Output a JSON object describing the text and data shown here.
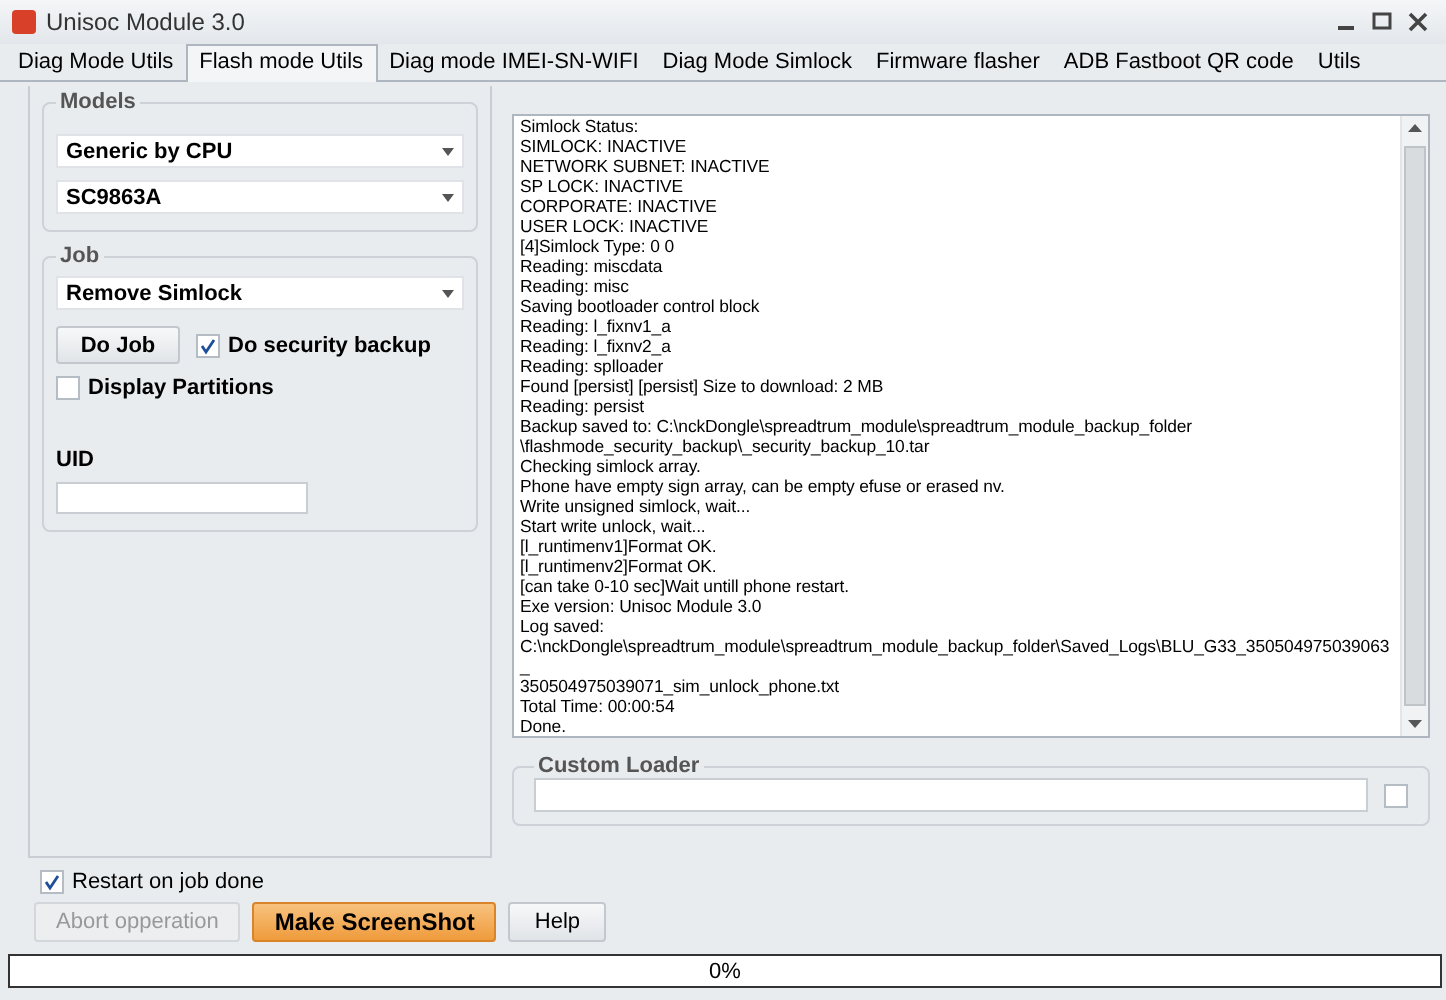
{
  "window": {
    "title": "Unisoc Module 3.0"
  },
  "tabs": [
    {
      "label": "Diag Mode Utils",
      "selected": false
    },
    {
      "label": "Flash mode Utils",
      "selected": true
    },
    {
      "label": "Diag mode IMEI-SN-WIFI",
      "selected": false
    },
    {
      "label": "Diag Mode Simlock",
      "selected": false
    },
    {
      "label": "Firmware flasher",
      "selected": false
    },
    {
      "label": "ADB Fastboot QR code",
      "selected": false
    },
    {
      "label": "Utils",
      "selected": false
    }
  ],
  "models": {
    "title": "Models",
    "dropdowns": [
      "Generic by CPU",
      "SC9863A"
    ]
  },
  "job": {
    "title": "Job",
    "dropdown": "Remove Simlock",
    "do_job_button": "Do Job",
    "security_backup": {
      "label": "Do security backup",
      "checked": true
    },
    "display_partitions": {
      "label": "Display Partitions",
      "checked": false
    },
    "uid_label": "UID"
  },
  "log": [
    "Simlock Status:",
    "SIMLOCK: INACTIVE",
    "NETWORK SUBNET: INACTIVE",
    "SP LOCK: INACTIVE",
    "CORPORATE: INACTIVE",
    "USER LOCK: INACTIVE",
    "[4]Simlock Type: 0  0",
    "Reading: miscdata",
    "Reading: misc",
    "Saving bootloader control block",
    "Reading: l_fixnv1_a",
    "Reading: l_fixnv2_a",
    "Reading: splloader",
    "Found [persist] [persist] Size to download: 2 MB",
    "Reading: persist",
    "Backup saved to: C:\\nckDongle\\spreadtrum_module\\spreadtrum_module_backup_folder",
    "\\flashmode_security_backup\\_security_backup_10.tar",
    "Checking simlock array.",
    "Phone have empty sign array, can be empty efuse or erased nv.",
    "Write unsigned simlock, wait...",
    "Start write unlock, wait...",
    "[l_runtimenv1]Format OK.",
    "[l_runtimenv2]Format OK.",
    "[can take 0-10 sec]Wait untill phone restart.",
    "Exe version: Unisoc Module 3.0",
    "Log saved:",
    "C:\\nckDongle\\spreadtrum_module\\spreadtrum_module_backup_folder\\Saved_Logs\\BLU_G33_350504975039063_",
    "350504975039071_sim_unlock_phone.txt",
    "Total Time: 00:00:54",
    "Done."
  ],
  "custom_loader": {
    "title": "Custom Loader",
    "checked": false
  },
  "restart_on_job_done": {
    "label": "Restart on job done",
    "checked": true
  },
  "buttons": [
    {
      "label": "Abort opperation",
      "kind": "disabled"
    },
    {
      "label": "Make ScreenShot",
      "kind": "accent"
    },
    {
      "label": "Help",
      "kind": "normal"
    }
  ],
  "progress": {
    "label": "0%",
    "level": 0
  }
}
